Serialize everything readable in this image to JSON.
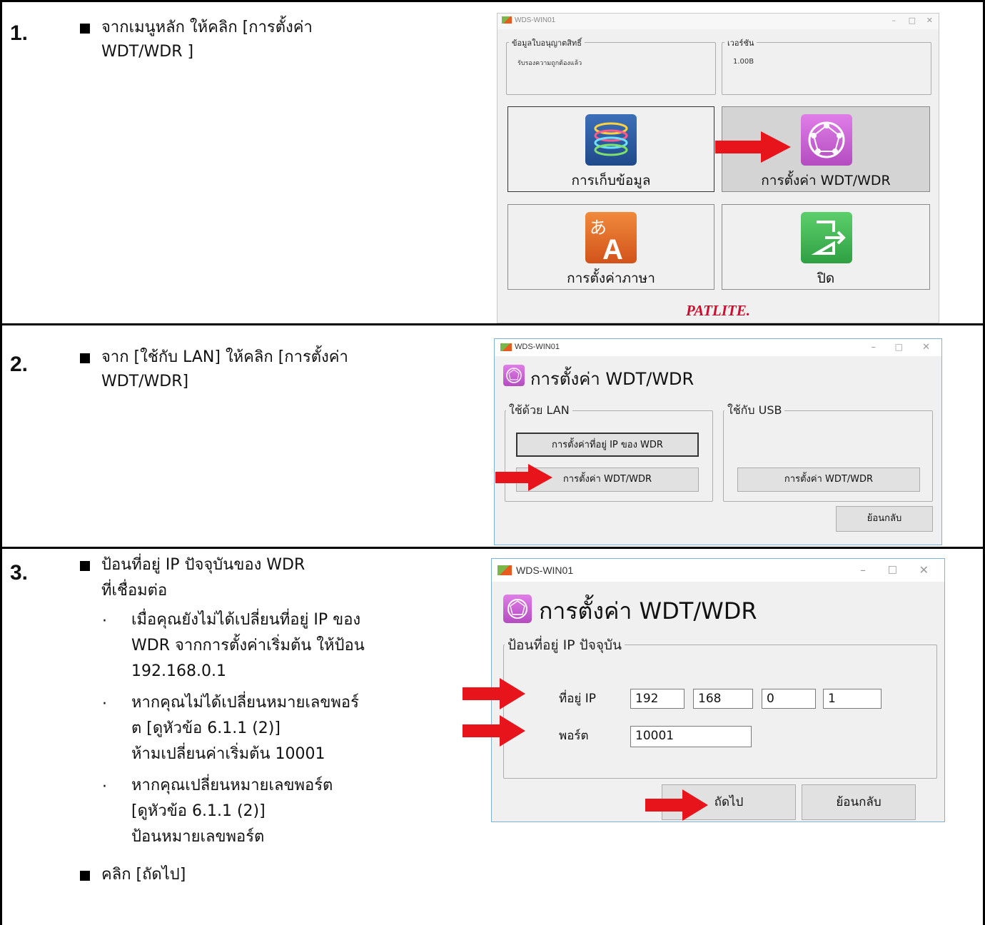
{
  "steps": [
    {
      "number": "1.",
      "instruction": "จากเมนูหลัก ให้คลิก [การตั้งค่า WDT/WDR ]",
      "instruction_lines": [
        "จากเมนูหลัก ให้คลิก [การตั้งค่า",
        "WDT/WDR ]"
      ]
    },
    {
      "number": "2.",
      "instruction": "จาก [ใช้กับ LAN] ให้คลิก [การตั้งค่า WDT/WDR]",
      "instruction_lines": [
        "จาก [ใช้กับ LAN] ให้คลิก [การตั้งค่า",
        "WDT/WDR]"
      ]
    },
    {
      "number": "3.",
      "instruction_lines": [
        "ป้อนที่อยู่ IP ปัจจุบันของ WDR",
        "ที่เชื่อมต่อ"
      ],
      "bullets": [
        {
          "lines": [
            "เมื่อคุณยังไม่ได้เปลี่ยนที่อยู่ IP ของ",
            "WDR จากการตั้งค่าเริ่มต้น ให้ป้อน",
            "192.168.0.1"
          ]
        },
        {
          "lines": [
            "หากคุณไม่ได้เปลี่ยนหมายเลขพอร์",
            "ต [ดูหัวข้อ 6.1.1 (2)]",
            "ห้ามเปลี่ยนค่าเริ่มต้น 10001"
          ]
        },
        {
          "lines": [
            "หากคุณเปลี่ยนหมายเลขพอร์ต",
            "[ดูหัวข้อ 6.1.1 (2)]",
            "ป้อนหมายเลขพอร์ต"
          ]
        }
      ],
      "final_instruction": "คลิก [ถัดไป]"
    }
  ],
  "screen1": {
    "window_title": "WDS-WIN01",
    "license_group": "ข้อมูลใบอนุญาตสิทธิ์",
    "license_value": "รับรองความถูกต้องแล้ว",
    "version_group": "เวอร์ชัน",
    "version_value": "1.00B",
    "tiles": [
      "การเก็บข้อมูล",
      "การตั้งค่า WDT/WDR",
      "การตั้งค่าภาษา",
      "ปิด"
    ],
    "brand": "PATLITE."
  },
  "screen2": {
    "window_title": "WDS-WIN01",
    "heading": "การตั้งค่า WDT/WDR",
    "lan_group": "ใช้ด้วย LAN",
    "usb_group": "ใช้กับ USB",
    "ip_button": "การตั้งค่าที่อยู่ IP ของ WDR",
    "lan_settings_button": "การตั้งค่า WDT/WDR",
    "usb_settings_button": "การตั้งค่า WDT/WDR",
    "back_button": "ย้อนกลับ"
  },
  "screen3": {
    "window_title": "WDS-WIN01",
    "heading": "การตั้งค่า WDT/WDR",
    "group": "ป้อนที่อยู่ IP ปัจจุบัน",
    "ip_label": "ที่อยู่ IP",
    "ip": [
      "192",
      "168",
      "0",
      "1"
    ],
    "port_label": "พอร์ต",
    "port": "10001",
    "next_button": "ถัดไป",
    "back_button": "ย้อนกลับ"
  },
  "colors": {
    "arrow": "#e8141c",
    "window_border": "#7fb3d5",
    "brand": "#c8102e"
  }
}
